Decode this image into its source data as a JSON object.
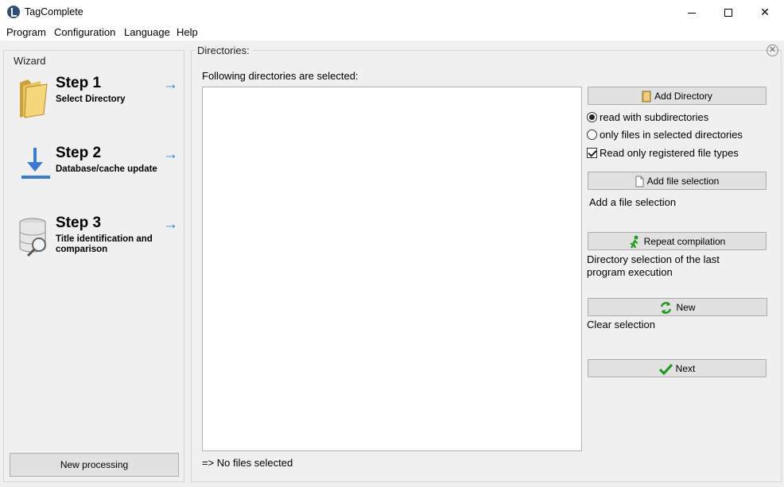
{
  "window": {
    "title": "TagComplete"
  },
  "menu": {
    "program": "Program",
    "configuration": "Configuration",
    "language": "Language",
    "help": "Help"
  },
  "wizard": {
    "label": "Wizard",
    "steps": [
      {
        "title": "Step 1",
        "subtitle": "Select Directory",
        "icon": "folder-icon"
      },
      {
        "title": "Step 2",
        "subtitle": "Database/cache update",
        "icon": "download-icon"
      },
      {
        "title": "Step 3",
        "subtitle": "Title identification and comparison",
        "icon": "database-search-icon"
      }
    ],
    "new_processing": "New processing"
  },
  "directories": {
    "label": "Directories:",
    "following": "Following directories are selected:",
    "status": "=> No files selected",
    "add_directory": "Add Directory",
    "options": {
      "read_sub": "read with subdirectories",
      "only_selected": "only files in selected directories",
      "registered_types": "Read only registered file types"
    },
    "add_file_selection": "Add file selection",
    "add_file_selection_desc": "Add a file selection",
    "repeat_compilation": "Repeat compilation",
    "repeat_desc": "Directory selection of the last program execution",
    "new": "New",
    "clear_desc": "Clear selection",
    "next": "Next"
  }
}
